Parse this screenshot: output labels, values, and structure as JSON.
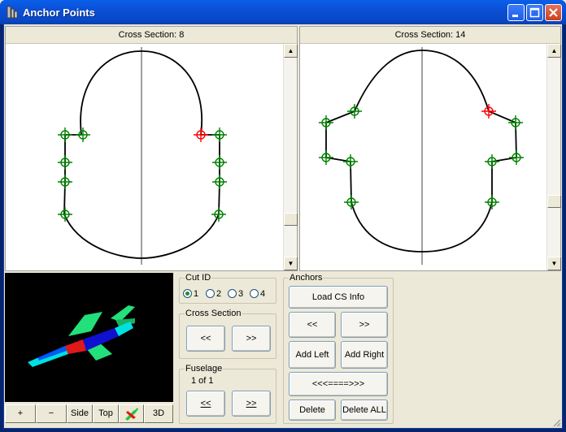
{
  "window": {
    "title": "Anchor Points"
  },
  "panes": [
    {
      "title": "Cross Section: 8"
    },
    {
      "title": "Cross Section: 14"
    }
  ],
  "view_buttons": {
    "plus": "+",
    "minus": "−",
    "side": "Side",
    "top": "Top",
    "three_d": "3D"
  },
  "cut_id": {
    "legend": "Cut ID",
    "options": [
      "1",
      "2",
      "3",
      "4"
    ],
    "selected": "1"
  },
  "cross_section": {
    "legend": "Cross Section",
    "prev": "<<",
    "next": ">>"
  },
  "fuselage": {
    "legend": "Fuselage",
    "count": "1 of 1",
    "prev": "<<",
    "next": ">>"
  },
  "anchors": {
    "legend": "Anchors",
    "load": "Load CS Info",
    "prev": "<<",
    "next": ">>",
    "add_left": "Add Left",
    "add_right": "Add Right",
    "spread": "<<<====>>>",
    "delete": "Delete",
    "delete_all": "Delete ALL"
  },
  "colors": {
    "anchor": "#008000",
    "selected_anchor": "#ff0000",
    "curve": "#000000",
    "centerline": "#808080",
    "background_3d": "#000000"
  }
}
